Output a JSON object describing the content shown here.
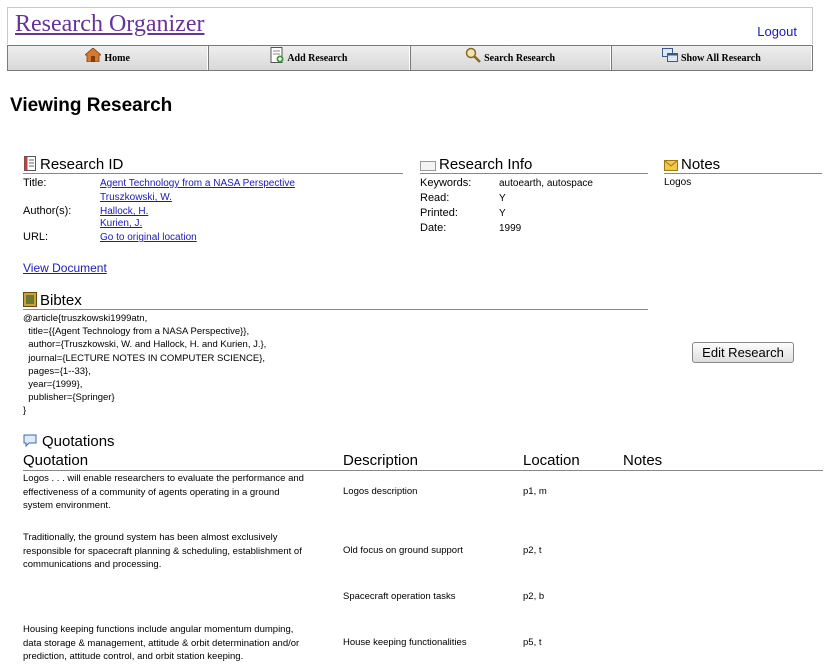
{
  "header": {
    "app_title": "Research Organizer",
    "logout_label": "Logout"
  },
  "nav": {
    "items": [
      {
        "label": "Home",
        "icon": "home-icon"
      },
      {
        "label": "Add Research",
        "icon": "add-document-icon"
      },
      {
        "label": "Search Research",
        "icon": "search-icon"
      },
      {
        "label": "Show All Research",
        "icon": "windows-icon"
      }
    ]
  },
  "page_title": "Viewing Research",
  "research_id": {
    "heading": "Research ID",
    "title_label": "Title:",
    "title_value": "Agent Technology from a NASA Perspective",
    "authors_label": "Author(s):",
    "authors": [
      "Truszkowski, W.",
      "Hallock, H.",
      "Kurien, J."
    ],
    "url_label": "URL:",
    "url_link": "Go to original location",
    "view_document": "View Document"
  },
  "research_info": {
    "heading": "Research Info",
    "fields": [
      {
        "label": "Keywords:",
        "value": "autoearth, autospace"
      },
      {
        "label": "Read:",
        "value": "Y"
      },
      {
        "label": "Printed:",
        "value": "Y"
      },
      {
        "label": "Date:",
        "value": "1999"
      }
    ]
  },
  "notes": {
    "heading": "Notes",
    "text": "Logos"
  },
  "bibtex": {
    "heading": "Bibtex",
    "lines": [
      "@article{truszkowski1999atn,",
      "  title={{Agent Technology from a NASA Perspective}},",
      "  author={Truszkowski, W. and Hallock, H. and Kurien, J.},",
      "  journal={LECTURE NOTES IN COMPUTER SCIENCE},",
      "  pages={1--33},",
      "  year={1999},",
      "  publisher={Springer}",
      "}"
    ]
  },
  "edit_button": "Edit Research",
  "quotations": {
    "heading": "Quotations",
    "columns": [
      "Quotation",
      "Description",
      "Location",
      "Notes"
    ],
    "rows": [
      {
        "quotation": [
          "Logos . . . will enable researchers to evaluate the performance and",
          "effectiveness of a community of agents operating in a ground",
          "system environment."
        ],
        "description": "Logos description",
        "location": "p1, m",
        "notes": ""
      },
      {
        "quotation": [
          "Traditionally, the ground system has been almost exclusively",
          "responsible for spacecraft planning & scheduling, establishment of",
          "communications and processing."
        ],
        "description": "Old focus on ground support",
        "location": "p2, t",
        "notes": ""
      },
      {
        "quotation": [],
        "description": "Spacecraft operation tasks",
        "location": "p2, b",
        "notes": ""
      },
      {
        "quotation": [
          "Housing keeping functions include angular momentum dumping,",
          "data storage & management, attitude & orbit determination and/or",
          "prediction, attitude control, and orbit station keeping."
        ],
        "description": "House keeping functionalities",
        "location": "p5, t",
        "notes": ""
      }
    ]
  }
}
